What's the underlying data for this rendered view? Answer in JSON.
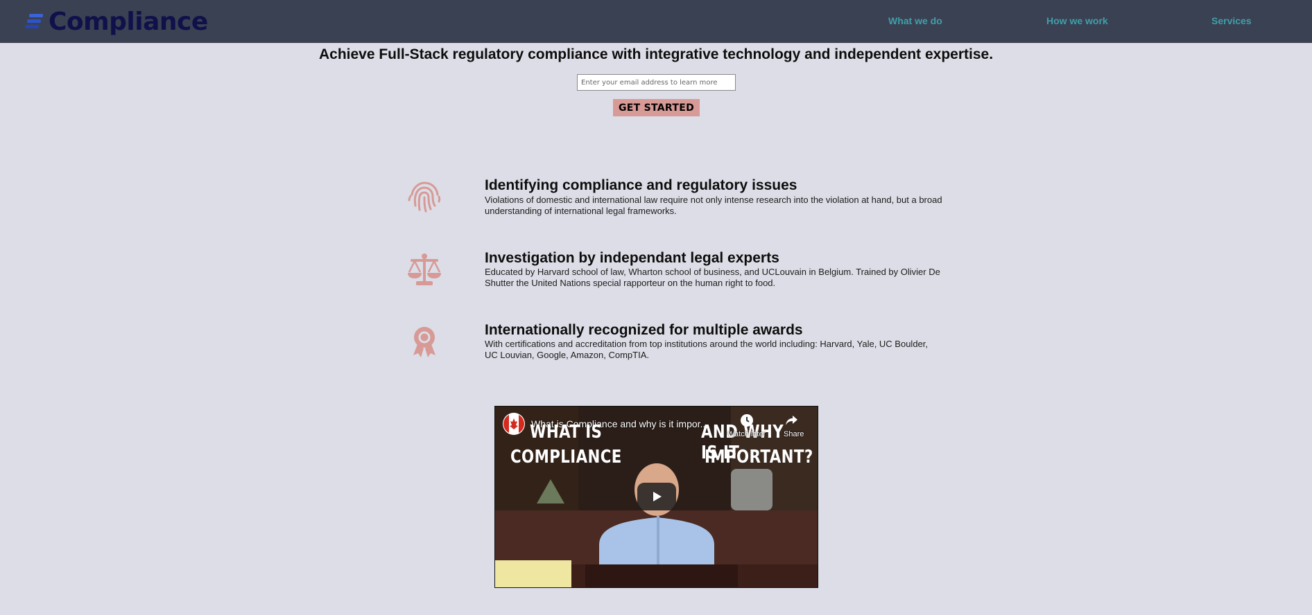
{
  "header": {
    "brand": "Compliance",
    "nav": [
      {
        "label": "What we do"
      },
      {
        "label": "How we work"
      },
      {
        "label": "Services"
      }
    ]
  },
  "hero": {
    "headline": "Achieve Full-Stack regulatory compliance with integrative technology and independent expertise.",
    "email_placeholder": "Enter your email address to learn more",
    "cta_label": "GET STARTED"
  },
  "features": [
    {
      "icon": "fingerprint-icon",
      "title": "Identifying compliance and regulatory issues",
      "text": "Violations of domestic and international law require not only intense research into the violation at hand, but a broad understanding of international legal frameworks."
    },
    {
      "icon": "scales-icon",
      "title": "Investigation by independant legal experts",
      "text": "Educated by Harvard school of law, Wharton school of business, and UCLouvain in Belgium. Trained by Olivier De Shutter the United Nations special rapporteur on the human right to food."
    },
    {
      "icon": "award-icon",
      "title": "Internationally recognized for multiple awards",
      "text": "With certifications and accreditation from top institutions around the world including: Harvard, Yale, UC Boulder, UC Louvian, Google, Amazon, CompTIA."
    }
  ],
  "video": {
    "title": "What is Compliance and why is it impor...",
    "watch_later": "Watch later",
    "share": "Share",
    "overlay_left": [
      "WHAT IS",
      "COMPLIANCE"
    ],
    "overlay_right": [
      "AND WHY IS IT",
      "IMPORTANT?"
    ]
  },
  "colors": {
    "header_bg": "#3a4152",
    "page_bg": "#dcdde6",
    "nav_link": "#3fa0aa",
    "accent": "#d79a96",
    "brand_text": "#10104a"
  }
}
